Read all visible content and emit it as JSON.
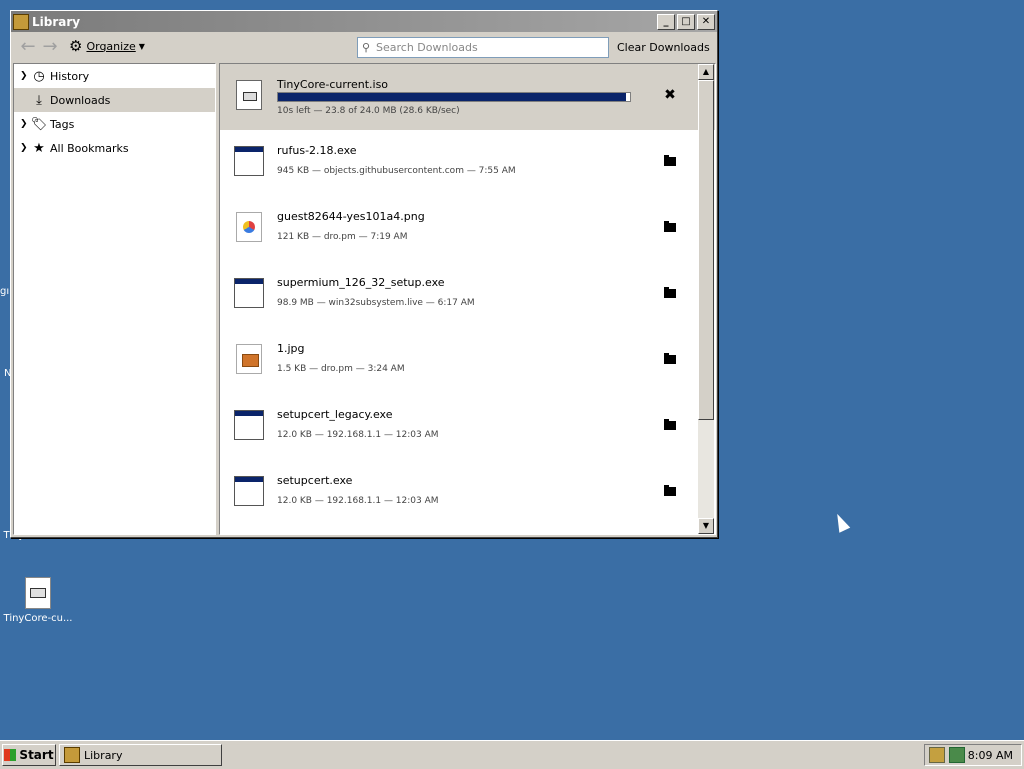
{
  "desktop": {
    "partial_labels": [
      "gı",
      "N"
    ],
    "icons": [
      {
        "label": "TinyCore-cu..."
      },
      {
        "label": "TinyCore-cu..."
      }
    ]
  },
  "window": {
    "title": "Library",
    "controls": {
      "minimize": "_",
      "maximize": "□",
      "close": "✕"
    },
    "toolbar": {
      "organize_label": "Organize",
      "search_placeholder": "Search Downloads",
      "clear_label": "Clear Downloads"
    },
    "sidebar": {
      "items": [
        {
          "label": "History",
          "icon": "clock-icon",
          "expandable": true,
          "selected": false
        },
        {
          "label": "Downloads",
          "icon": "download-icon",
          "expandable": false,
          "selected": true
        },
        {
          "label": "Tags",
          "icon": "tag-icon",
          "expandable": true,
          "selected": false
        },
        {
          "label": "All Bookmarks",
          "icon": "star-icon",
          "expandable": true,
          "selected": false
        }
      ]
    },
    "downloads": [
      {
        "name": "TinyCore-current.iso",
        "meta": "10s left — 23.8 of 24.0 MB (28.6 KB/sec)",
        "icon": "iso-file-icon",
        "in_progress": true,
        "progress": 0.99,
        "action": "cancel-icon"
      },
      {
        "name": "rufus-2.18.exe",
        "meta": "945 KB — objects.githubusercontent.com — 7:55 AM",
        "icon": "exe-file-icon",
        "action": "folder-icon"
      },
      {
        "name": "guest82644-yes101a4.png",
        "meta": "121 KB — dro.pm — 7:19 AM",
        "icon": "png-file-icon",
        "action": "folder-icon"
      },
      {
        "name": "supermium_126_32_setup.exe",
        "meta": "98.9 MB — win32subsystem.live — 6:17 AM",
        "icon": "exe-file-icon",
        "action": "folder-icon"
      },
      {
        "name": "1.jpg",
        "meta": "1.5 KB — dro.pm — 3:24 AM",
        "icon": "jpg-file-icon",
        "action": "folder-icon"
      },
      {
        "name": "setupcert_legacy.exe",
        "meta": "12.0 KB — 192.168.1.1 — 12:03 AM",
        "icon": "exe-file-icon",
        "action": "folder-icon"
      },
      {
        "name": "setupcert.exe",
        "meta": "12.0 KB — 192.168.1.1 — 12:03 AM",
        "icon": "exe-file-icon",
        "action": "folder-icon"
      }
    ]
  },
  "taskbar": {
    "start_label": "Start",
    "task_label": "Library",
    "clock": "8:09 AM"
  }
}
